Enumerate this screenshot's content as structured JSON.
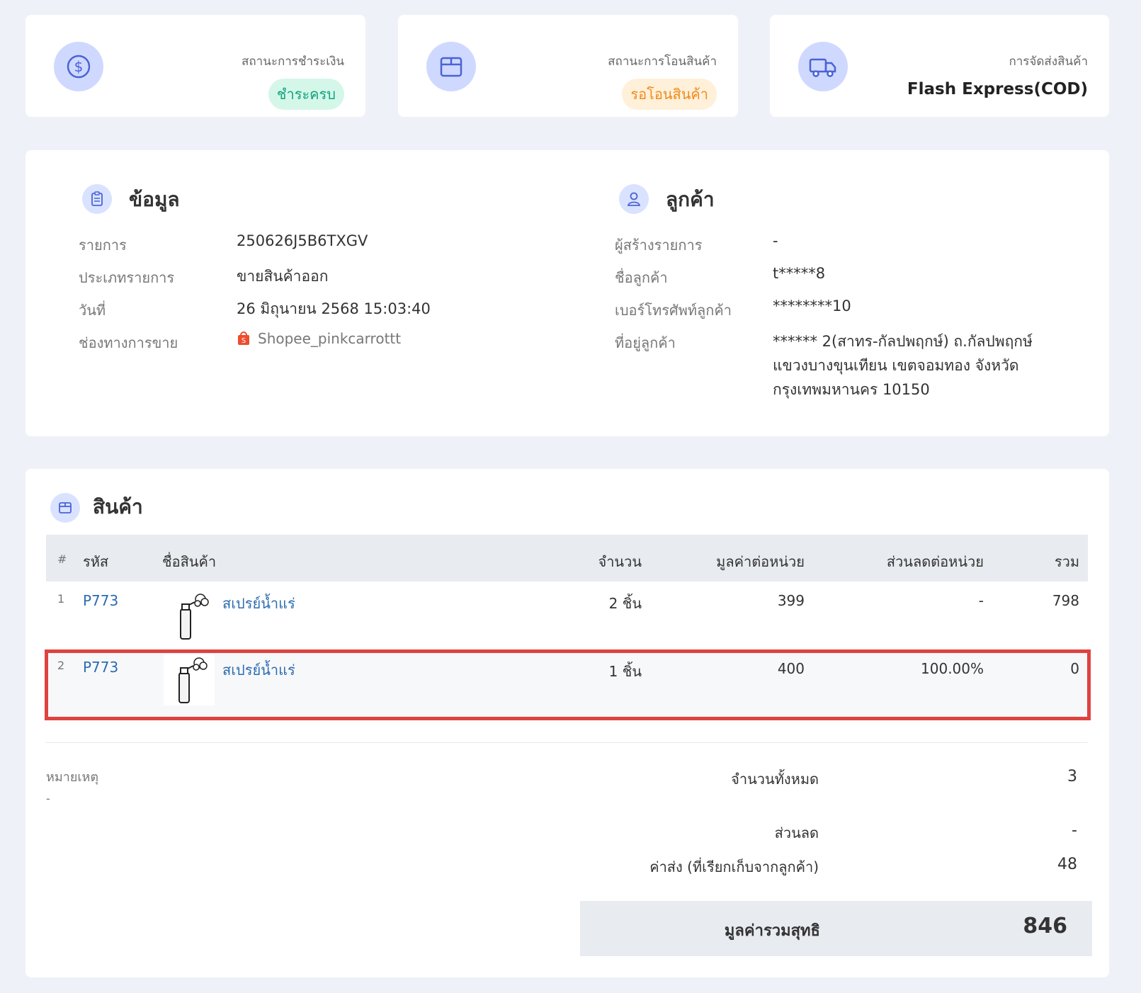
{
  "status_cards": {
    "payment": {
      "label": "สถานะการชำระเงิน",
      "badge": "ชำระครบ",
      "icon": "dollar-icon",
      "badge_color": "#10a37a"
    },
    "transfer": {
      "label": "สถานะการโอนสินค้า",
      "badge": "รอโอนสินค้า",
      "icon": "box-icon",
      "badge_color": "#f08a1c"
    },
    "shipping": {
      "label": "การจัดส่งสินค้า",
      "value": "Flash Express(COD)",
      "icon": "truck-icon"
    }
  },
  "info": {
    "title": "ข้อมูล",
    "rows": [
      {
        "label": "รายการ",
        "value": "250626J5B6TXGV"
      },
      {
        "label": "ประเภทรายการ",
        "value": "ขายสินค้าออก"
      },
      {
        "label": "วันที่",
        "value": "26 มิถุนายน 2568 15:03:40"
      },
      {
        "label": "ช่องทางการขาย",
        "value": "Shopee_pinkcarrottt"
      }
    ]
  },
  "customer": {
    "title": "ลูกค้า",
    "rows": [
      {
        "label": "ผู้สร้างรายการ",
        "value": "-"
      },
      {
        "label": "ชื่อลูกค้า",
        "value": "t*****8"
      },
      {
        "label": "เบอร์โทรศัพท์ลูกค้า",
        "value": "********10"
      },
      {
        "label": "ที่อยู่ลูกค้า",
        "value": ""
      }
    ],
    "address_lines": [
      "****** 2(สาทร-กัลปพฤกษ์) ถ.กัลปพฤกษ์",
      "แขวงบางขุนเทียน เขตจอมทอง จังหวัด",
      "กรุงเทพมหานคร 10150"
    ]
  },
  "products": {
    "title": "สินค้า",
    "headers": {
      "hash": "#",
      "code": "รหัส",
      "name": "ชื่อสินค้า",
      "qty": "จำนวน",
      "unit_price": "มูลค่าต่อหน่วย",
      "unit_discount": "ส่วนลดต่อหน่วย",
      "total": "รวม"
    },
    "rows": [
      {
        "idx": "1",
        "code": "P773",
        "name": "สเปรย์น้ำแร่",
        "qty": "2 ชิ้น",
        "unit_price": "399",
        "unit_discount": "-",
        "total": "798"
      },
      {
        "idx": "2",
        "code": "P773",
        "name": "สเปรย์น้ำแร่",
        "qty": "1 ชิ้น",
        "unit_price": "400",
        "unit_discount": "100.00%",
        "total": "0"
      }
    ]
  },
  "note": {
    "label": "หมายเหตุ",
    "value": "-"
  },
  "summary": {
    "total_qty_label": "จำนวนทั้งหมด",
    "total_qty": "3",
    "discount_label": "ส่วนลด",
    "discount": "-",
    "shipping_label": "ค่าส่ง (ที่เรียกเก็บจากลูกค้า)",
    "shipping": "48",
    "net_label": "มูลค่ารวมสุทธิ",
    "net": "846"
  },
  "colors": {
    "accent": "#2b6cb0",
    "icon_bg": "#cfd9ff",
    "icon_stroke": "#4a63d6",
    "highlight": "#e0423f"
  }
}
